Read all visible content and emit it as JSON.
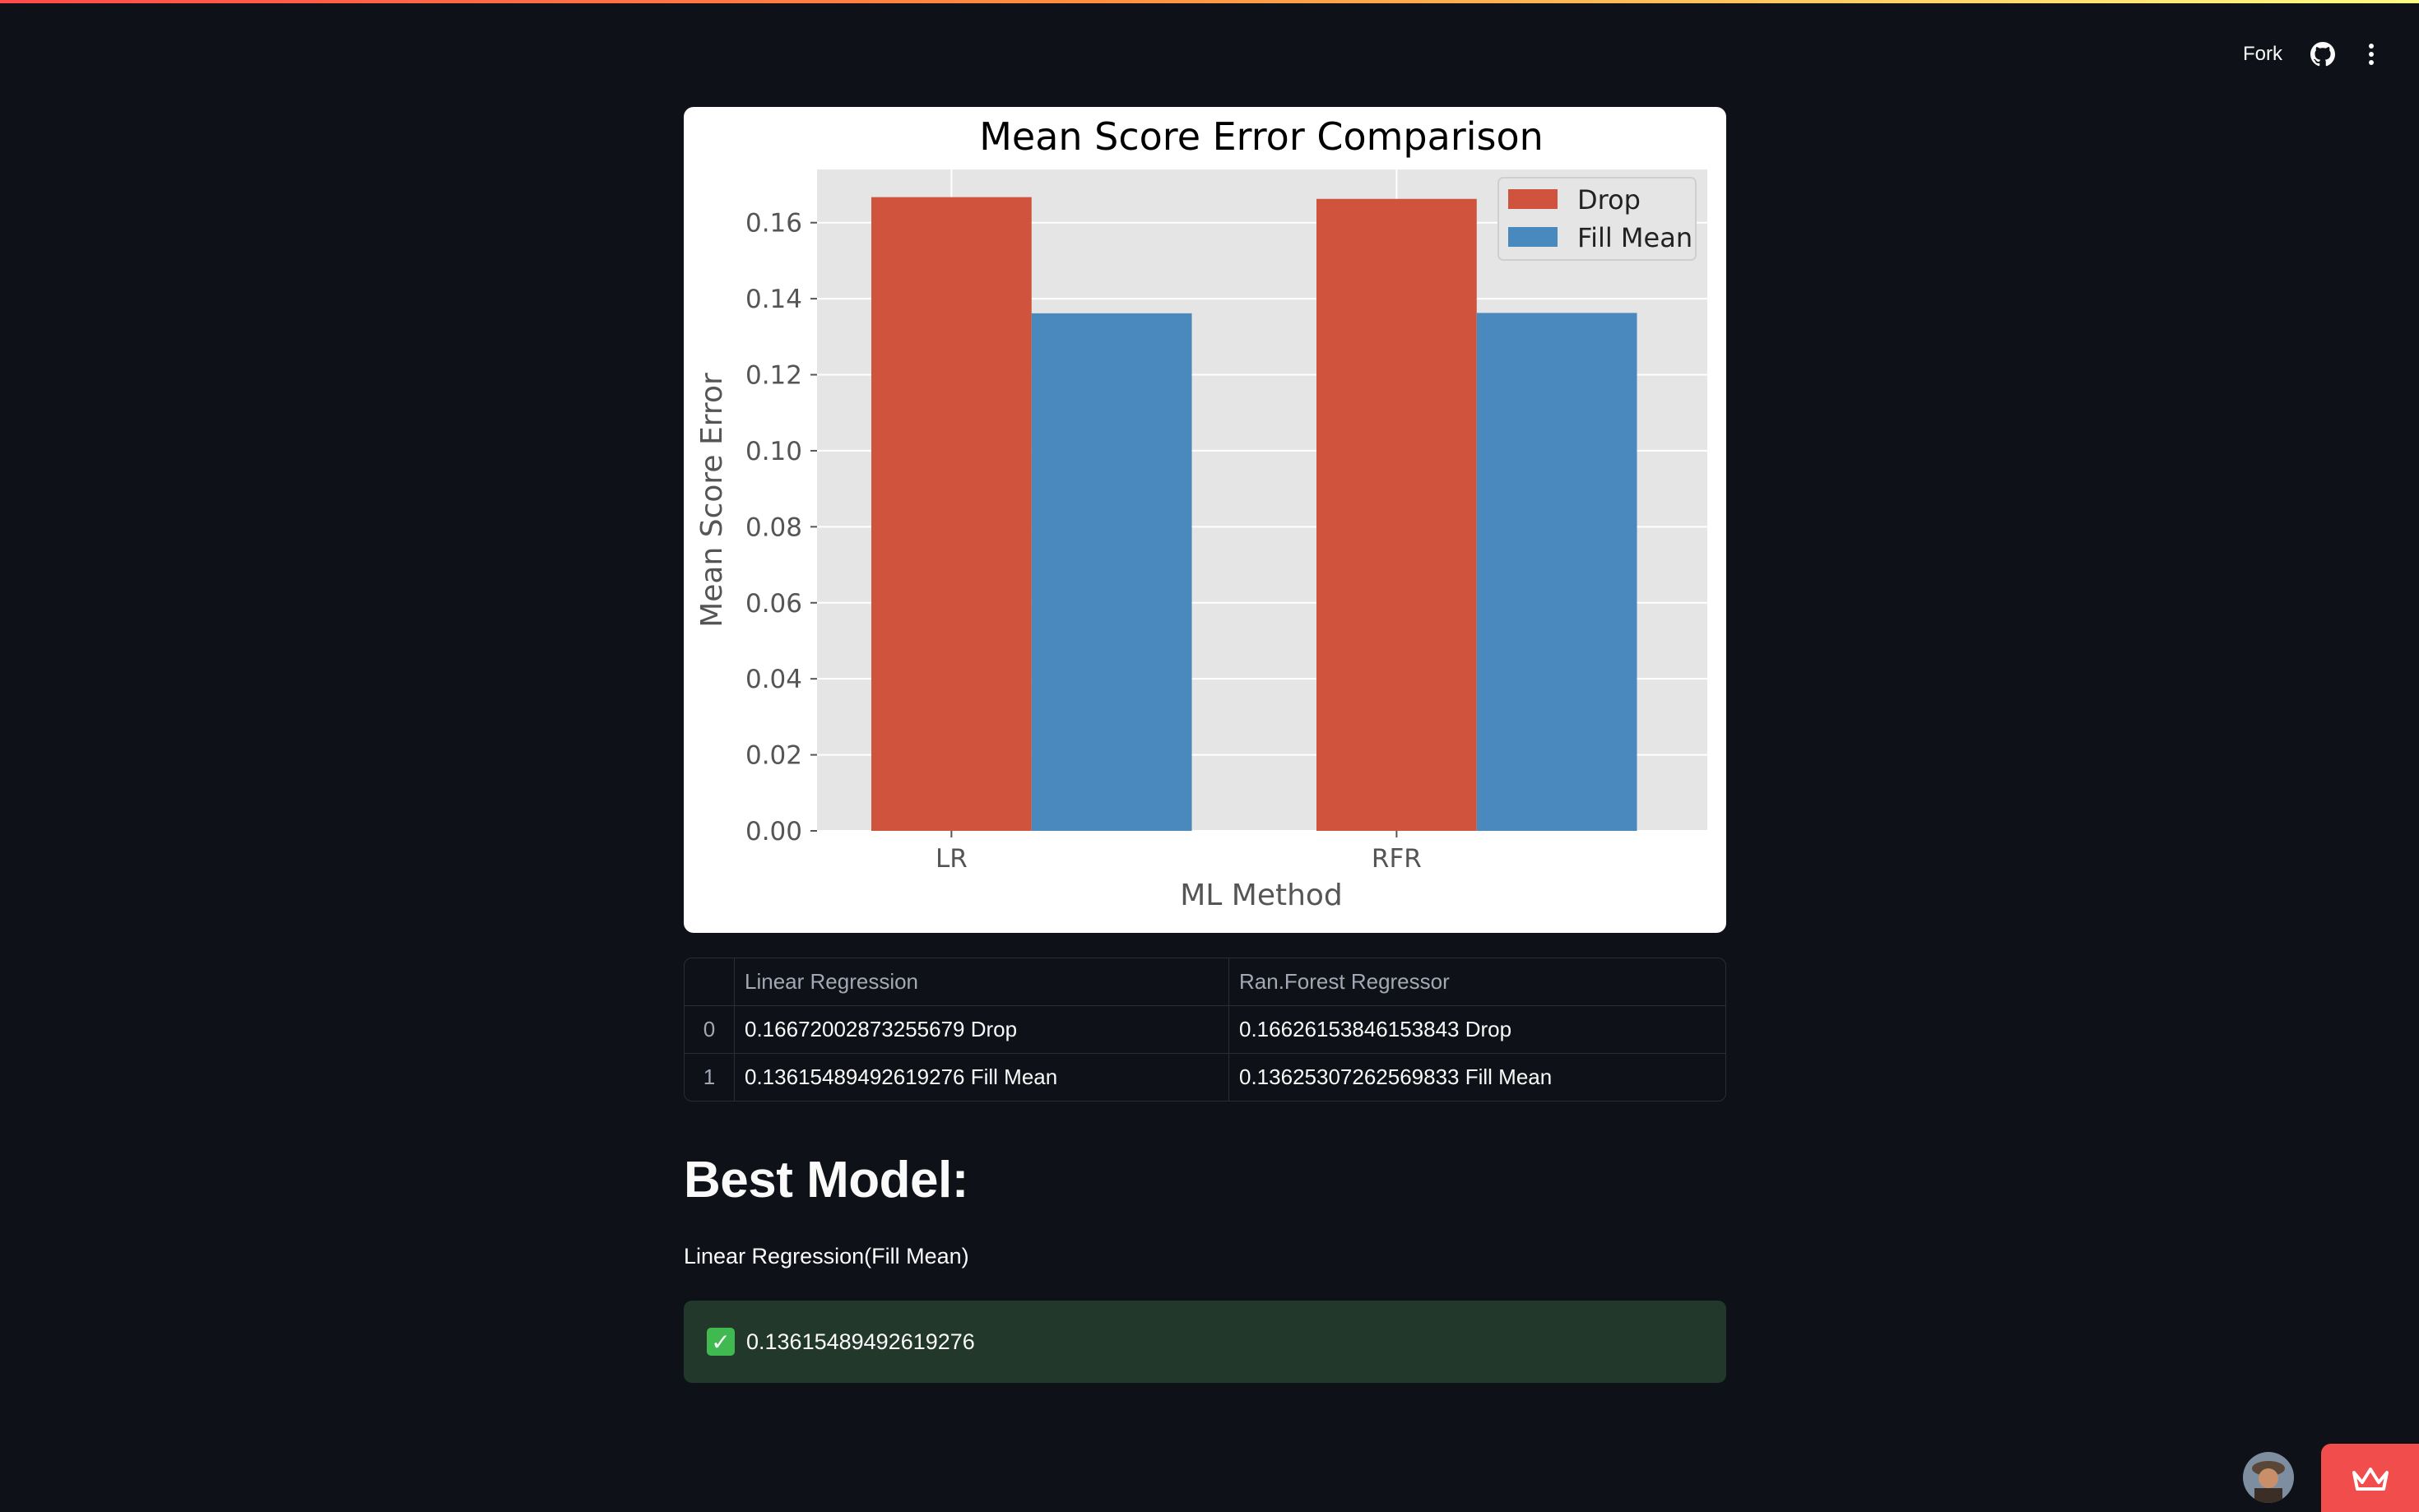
{
  "header": {
    "fork_label": "Fork",
    "icons": [
      "github-icon",
      "more-vertical-icon"
    ]
  },
  "chart_data": {
    "type": "bar",
    "title": "Mean Score Error Comparison",
    "xlabel": "ML Method",
    "ylabel": "Mean Score Error",
    "categories": [
      "LR",
      "RFR"
    ],
    "series": [
      {
        "name": "Drop",
        "color": "#d0533d",
        "values": [
          0.16672002873255679,
          0.16626153846153843
        ]
      },
      {
        "name": "Fill Mean",
        "color": "#4a89bd",
        "values": [
          0.13615489492619276,
          0.13625307262569833
        ]
      }
    ],
    "ylim": [
      0,
      0.174
    ],
    "yticks": [
      "0.00",
      "0.02",
      "0.04",
      "0.06",
      "0.08",
      "0.10",
      "0.12",
      "0.14",
      "0.16"
    ],
    "grid": true,
    "legend": "top-right"
  },
  "table": {
    "headers": [
      "",
      "Linear Regression",
      "Ran.Forest Regressor"
    ],
    "rows": [
      {
        "index": "0",
        "lr": "0.16672002873255679 Drop",
        "rfr": "0.16626153846153843 Drop"
      },
      {
        "index": "1",
        "lr": "0.13615489492619276 Fill Mean",
        "rfr": "0.13625307262569833 Fill Mean"
      }
    ]
  },
  "best": {
    "title": "Best Model:",
    "text": "Linear Regression(Fill Mean)",
    "success_value": "0.13615489492619276",
    "success_icon": "check-icon"
  },
  "colors": {
    "background": "#0e1117",
    "success_bg": "#21382b",
    "accent": "#f14d4d"
  }
}
